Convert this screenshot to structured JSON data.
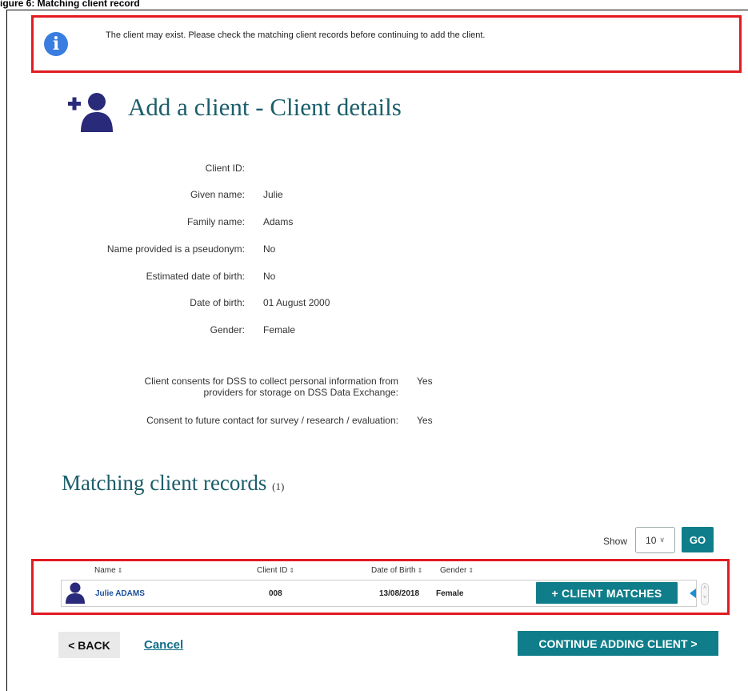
{
  "figure_caption": "igure 6: Matching client record",
  "alert": {
    "message": "The client may exist. Please check the matching client records before continuing to add the client."
  },
  "page": {
    "title": "Add a client - Client details"
  },
  "details": [
    {
      "label": "Client ID:",
      "value": ""
    },
    {
      "label": "Given name:",
      "value": "Julie"
    },
    {
      "label": "Family name:",
      "value": "Adams"
    },
    {
      "label": "Name provided is a pseudonym:",
      "value": "No"
    },
    {
      "label": "Estimated date of birth:",
      "value": "No"
    },
    {
      "label": "Date of birth:",
      "value": "01 August 2000"
    },
    {
      "label": "Gender:",
      "value": "Female"
    }
  ],
  "consents": [
    {
      "label_line1": "Client consents for DSS to collect personal information from",
      "label_line2": "providers for storage on DSS Data Exchange:",
      "value": "Yes"
    },
    {
      "label_line1": "Consent to future contact for survey / research / evaluation:",
      "value": "Yes"
    }
  ],
  "matches": {
    "title": "Matching client records",
    "count": "(1)",
    "show_label": "Show",
    "show_value": "10",
    "go_label": "GO",
    "columns": [
      "Name",
      "Client ID",
      "Date of Birth",
      "Gender"
    ],
    "rows": [
      {
        "name": "Julie ADAMS",
        "client_id": "008",
        "dob": "13/08/2018",
        "gender": "Female",
        "action": "+ CLIENT MATCHES"
      }
    ]
  },
  "footer": {
    "back_label": "< BACK",
    "cancel_label": "Cancel",
    "continue_label": "CONTINUE ADDING CLIENT >"
  },
  "colors": {
    "accent": "#0f7e8a",
    "title": "#1b5e6a",
    "highlight_border": "#e11b22",
    "icon": "#2a2a7a"
  }
}
